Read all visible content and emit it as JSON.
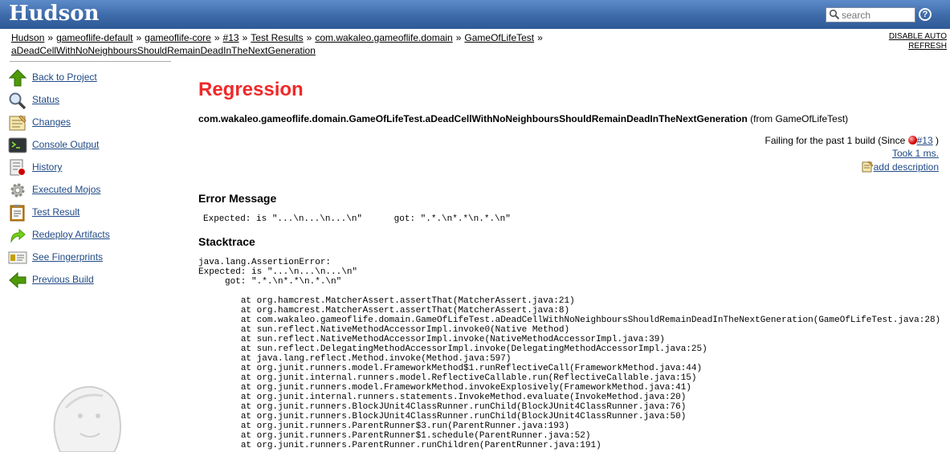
{
  "header": {
    "logo": "Hudson",
    "search_placeholder": "search",
    "help_glyph": "?"
  },
  "breadcrumbs": [
    "Hudson",
    "gameoflife-default",
    "gameoflife-core",
    "#13",
    "Test Results",
    "com.wakaleo.gameoflife.domain",
    "GameOfLifeTest",
    "aDeadCellWithNoNeighboursShouldRemainDeadInTheNextGeneration"
  ],
  "breadcrumb_separator": "»",
  "auto_refresh": {
    "line1": "DISABLE AUTO",
    "line2": "REFRESH"
  },
  "sidebar": {
    "items": [
      {
        "label": "Back to Project",
        "icon": "up-arrow-icon"
      },
      {
        "label": "Status",
        "icon": "magnifier-icon"
      },
      {
        "label": "Changes",
        "icon": "notepad-icon"
      },
      {
        "label": "Console Output",
        "icon": "terminal-icon"
      },
      {
        "label": "History",
        "icon": "history-icon"
      },
      {
        "label": "Executed Mojos",
        "icon": "gear-icon"
      },
      {
        "label": "Test Result",
        "icon": "clipboard-icon"
      },
      {
        "label": "Redeploy Artifacts",
        "icon": "redeploy-arrow-icon"
      },
      {
        "label": "See Fingerprints",
        "icon": "fingerprint-card-icon"
      },
      {
        "label": "Previous Build",
        "icon": "left-arrow-icon"
      }
    ]
  },
  "main": {
    "title": "Regression",
    "test_name": "com.wakaleo.gameoflife.domain.GameOfLifeTest.aDeadCellWithNoNeighboursShouldRemainDeadInTheNextGeneration",
    "test_from": " (from GameOfLifeTest)",
    "failing_prefix": "Failing for the past 1 build (Since ",
    "failing_build": "#13",
    "failing_suffix": " )",
    "took": "Took 1 ms.",
    "add_description": "add description",
    "error_heading": "Error Message",
    "error_message": "Expected: is \"...\\n...\\n...\\n\"      got: \".*.\\n*.*\\n.*.\\n\"",
    "stacktrace_heading": "Stacktrace",
    "stacktrace": "java.lang.AssertionError:\nExpected: is \"...\\n...\\n...\\n\"\n     got: \".*.\\n*.*\\n.*.\\n\"\n\n\tat org.hamcrest.MatcherAssert.assertThat(MatcherAssert.java:21)\n\tat org.hamcrest.MatcherAssert.assertThat(MatcherAssert.java:8)\n\tat com.wakaleo.gameoflife.domain.GameOfLifeTest.aDeadCellWithNoNeighboursShouldRemainDeadInTheNextGeneration(GameOfLifeTest.java:28)\n\tat sun.reflect.NativeMethodAccessorImpl.invoke0(Native Method)\n\tat sun.reflect.NativeMethodAccessorImpl.invoke(NativeMethodAccessorImpl.java:39)\n\tat sun.reflect.DelegatingMethodAccessorImpl.invoke(DelegatingMethodAccessorImpl.java:25)\n\tat java.lang.reflect.Method.invoke(Method.java:597)\n\tat org.junit.runners.model.FrameworkMethod$1.runReflectiveCall(FrameworkMethod.java:44)\n\tat org.junit.internal.runners.model.ReflectiveCallable.run(ReflectiveCallable.java:15)\n\tat org.junit.runners.model.FrameworkMethod.invokeExplosively(FrameworkMethod.java:41)\n\tat org.junit.internal.runners.statements.InvokeMethod.evaluate(InvokeMethod.java:20)\n\tat org.junit.runners.BlockJUnit4ClassRunner.runChild(BlockJUnit4ClassRunner.java:76)\n\tat org.junit.runners.BlockJUnit4ClassRunner.runChild(BlockJUnit4ClassRunner.java:50)\n\tat org.junit.runners.ParentRunner$3.run(ParentRunner.java:193)\n\tat org.junit.runners.ParentRunner$1.schedule(ParentRunner.java:52)\n\tat org.junit.runners.ParentRunner.runChildren(ParentRunner.java:191)"
  },
  "colors": {
    "header": "#3d6aa8",
    "title": "#ef2929",
    "link": "#204a87"
  }
}
